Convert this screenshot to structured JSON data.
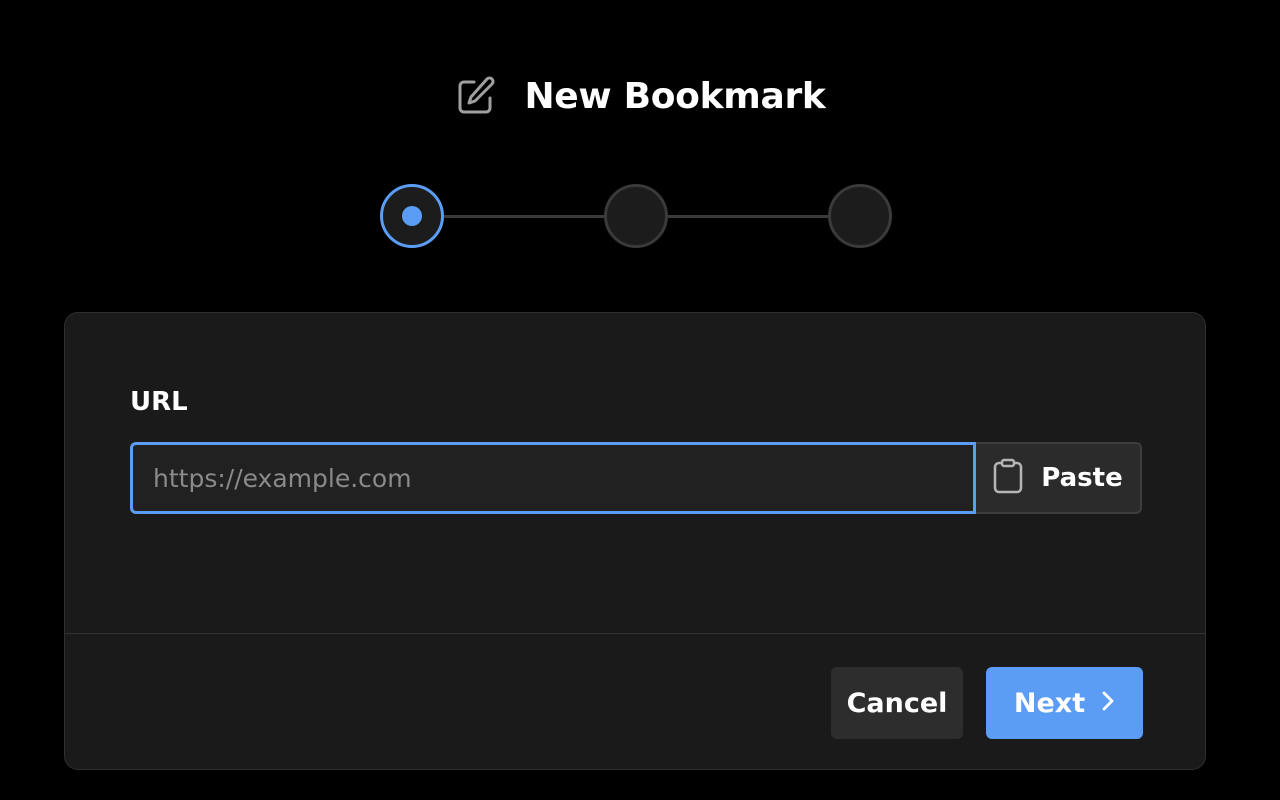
{
  "header": {
    "title": "New Bookmark",
    "icon": "edit-icon"
  },
  "stepper": {
    "total_steps": 3,
    "current_step": 1,
    "accent_color": "#5b9cf5"
  },
  "form": {
    "url_label": "URL",
    "url_value": "",
    "url_placeholder": "https://example.com",
    "paste_label": "Paste",
    "paste_icon": "clipboard-icon"
  },
  "footer": {
    "cancel_label": "Cancel",
    "next_label": "Next",
    "next_icon": "chevron-right-icon"
  }
}
